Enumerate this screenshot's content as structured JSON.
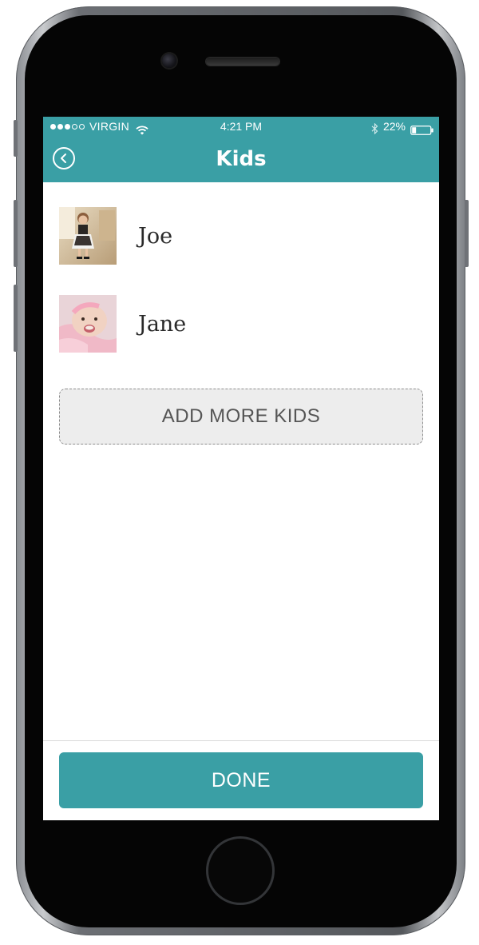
{
  "status_bar": {
    "carrier": "VIRGIN",
    "time": "4:21 PM",
    "battery": "22%",
    "signal_icon": "signal-dots-icon",
    "wifi_icon": "wifi-icon",
    "bluetooth_icon": "bluetooth-icon",
    "battery_level": 0.22
  },
  "nav": {
    "title": "Kids",
    "back_icon": "chevron-left-icon"
  },
  "kids": [
    {
      "name": "Joe",
      "photo": "kid-photo-joe"
    },
    {
      "name": "Jane",
      "photo": "kid-photo-jane"
    }
  ],
  "add_more_label": "ADD MORE KIDS",
  "done_label": "DONE",
  "colors": {
    "accent": "#3a9fa5",
    "add_button_bg": "#ededed",
    "text": "#2a2a2a"
  }
}
